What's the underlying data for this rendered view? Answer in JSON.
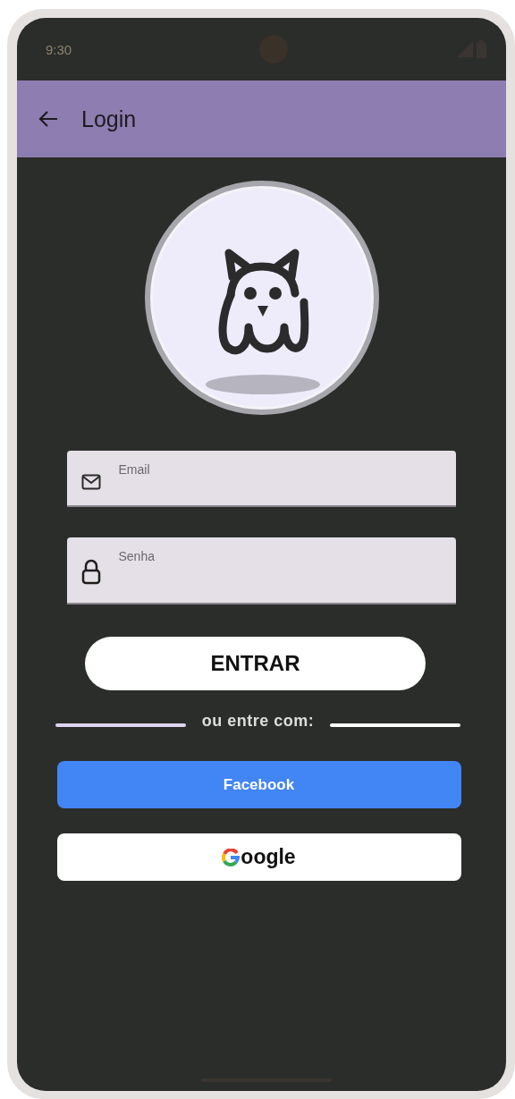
{
  "status_bar": {
    "time": "9:30"
  },
  "app_bar": {
    "title": "Login"
  },
  "fields": [
    {
      "kind": "email",
      "placeholder": "Email"
    },
    {
      "kind": "password",
      "placeholder": "Senha"
    }
  ],
  "submit_button": {
    "label": "ENTRAR"
  },
  "divider": {
    "label": "ou entre com:"
  },
  "social_buttons": [
    {
      "kind": "facebook",
      "label": "Facebook"
    },
    {
      "kind": "google",
      "label": "oogle"
    }
  ]
}
